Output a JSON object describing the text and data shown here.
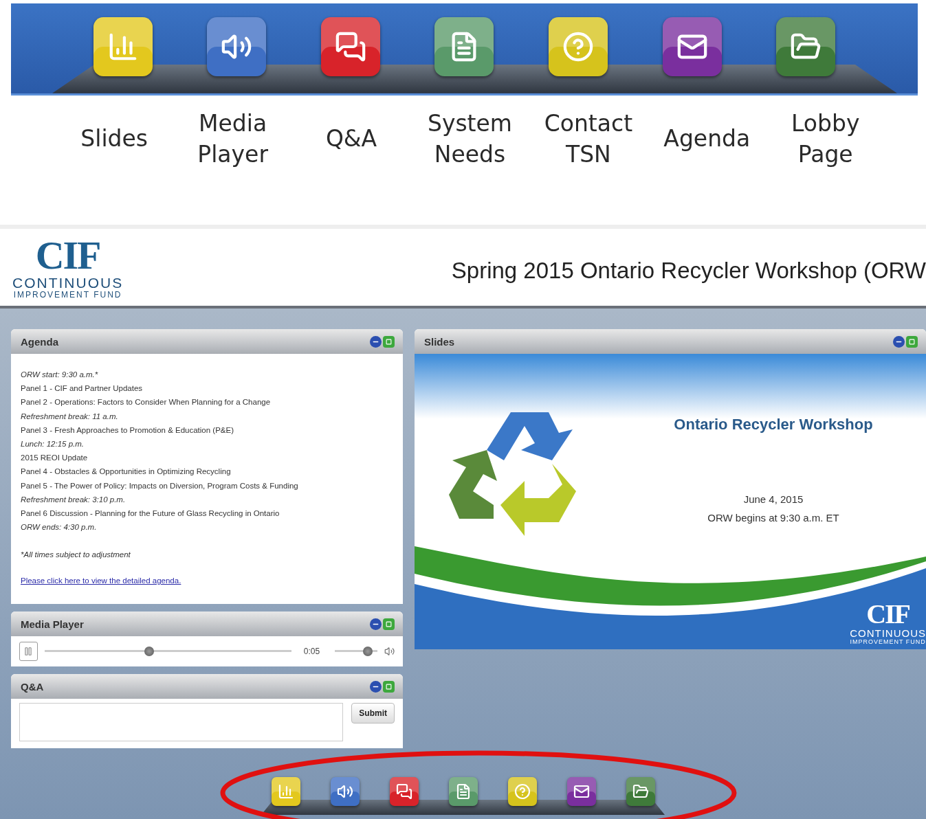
{
  "feature_bar": {
    "items": [
      {
        "kind": "slides",
        "label": "Slides",
        "color": "#e3c81e"
      },
      {
        "kind": "media",
        "label": "Media Player",
        "color": "#3f6fc4"
      },
      {
        "kind": "qa",
        "label": "Q&A",
        "color": "#d8232a"
      },
      {
        "kind": "system",
        "label": "System Needs",
        "color": "#5a9a6a"
      },
      {
        "kind": "contact",
        "label": "Contact TSN",
        "color": "#d6c31c"
      },
      {
        "kind": "agenda",
        "label": "Agenda",
        "color": "#7a2f9e"
      },
      {
        "kind": "lobby",
        "label": "Lobby Page",
        "color": "#3f7a3a"
      }
    ]
  },
  "header": {
    "logo": {
      "mark": "CIF",
      "line1": "CONTINUOUS",
      "line2": "IMPROVEMENT FUND"
    },
    "title": "Spring 2015 Ontario Recycler Workshop (ORW"
  },
  "agenda": {
    "title": "Agenda",
    "lines": [
      {
        "text": "ORW start: 9:30 a.m.*",
        "italic": true
      },
      {
        "text": "Panel 1 - CIF and Partner Updates",
        "italic": false
      },
      {
        "text": "Panel 2 - Operations: Factors to Consider When Planning for a Change",
        "italic": false
      },
      {
        "text": "Refreshment break: 11 a.m.",
        "italic": true
      },
      {
        "text": "Panel 3 - Fresh Approaches to Promotion & Education (P&E)",
        "italic": false
      },
      {
        "text": "Lunch: 12:15 p.m.",
        "italic": true
      },
      {
        "text": "2015 REOI Update",
        "italic": false
      },
      {
        "text": "Panel 4 - Obstacles & Opportunities in Optimizing Recycling",
        "italic": false
      },
      {
        "text": "Panel 5 - The Power of Policy: Impacts on Diversion, Program Costs & Funding",
        "italic": false
      },
      {
        "text": "Refreshment break: 3:10 p.m.",
        "italic": true
      },
      {
        "text": "Panel 6 Discussion - Planning for the Future of Glass Recycling in Ontario",
        "italic": false
      },
      {
        "text": "ORW ends: 4:30 p.m.",
        "italic": true
      }
    ],
    "note": "*All times subject to adjustment",
    "link": "Please click here to view the detailed agenda."
  },
  "media_player": {
    "title": "Media Player",
    "position": {
      "level": 0.42
    },
    "time": "0:05",
    "volume": {
      "level": 0.85
    }
  },
  "qa": {
    "title": "Q&A",
    "submit": "Submit"
  },
  "slides": {
    "title": "Slides",
    "heading": "Ontario Recycler Workshop",
    "date": "June 4, 2015",
    "time": "ORW begins at 9:30 a.m. ET",
    "logo": {
      "mark": "CIF",
      "line1": "CONTINUOUS",
      "line2": "IMPROVEMENT FUND"
    }
  },
  "dock": {
    "items": [
      {
        "kind": "slides",
        "color": "#e3c81e"
      },
      {
        "kind": "media",
        "color": "#3f6fc4"
      },
      {
        "kind": "qa",
        "color": "#d8232a"
      },
      {
        "kind": "system",
        "color": "#5a9a6a"
      },
      {
        "kind": "contact",
        "color": "#d6c31c"
      },
      {
        "kind": "agenda",
        "color": "#7a2f9e"
      },
      {
        "kind": "lobby",
        "color": "#3f7a3a"
      }
    ]
  }
}
